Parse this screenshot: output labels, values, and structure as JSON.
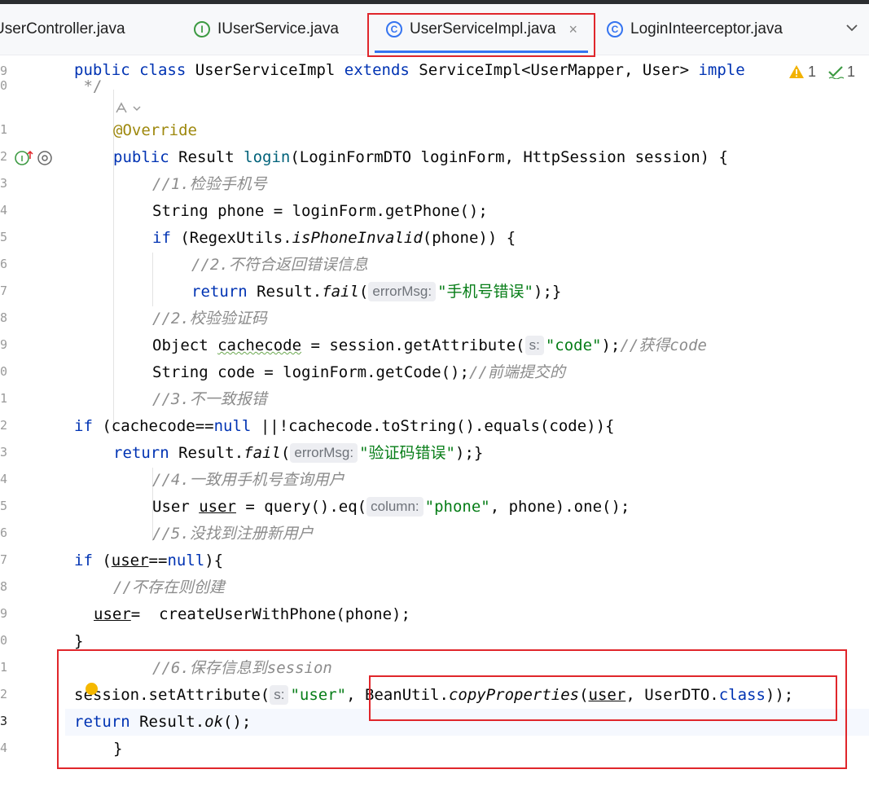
{
  "tabs": [
    {
      "label": "UserController.java",
      "icon": "class-icon",
      "active": false
    },
    {
      "label": "IUserService.java",
      "icon": "interface-icon",
      "active": false
    },
    {
      "label": "UserServiceImpl.java",
      "icon": "class-icon",
      "active": true
    },
    {
      "label": "LoginInteerceptor.java",
      "icon": "class-icon",
      "active": false
    }
  ],
  "tab_close": "×",
  "inspections": {
    "warnings": "1",
    "ok": "1"
  },
  "gutter_numbers": [
    "9",
    "0",
    "",
    "1",
    "2",
    "3",
    "4",
    "5",
    "6",
    "7",
    "8",
    "9",
    "0",
    "1",
    "2",
    "3",
    "4",
    "5",
    "6",
    "7",
    "8",
    "9",
    "0",
    "1",
    "2",
    "3",
    "4",
    ""
  ],
  "code": {
    "class_decl": {
      "kw1": "public",
      "kw2": "class",
      "name": " UserServiceImpl ",
      "kw3": "extends",
      "rest": " ServiceImpl<UserMapper, User> ",
      "kw4": "imple"
    },
    "doc_end": " */",
    "annotation": "@Override",
    "login_sig": {
      "kw": "public",
      "t1": " Result ",
      "fn": "login",
      "rest": "(LoginFormDTO loginForm, HttpSession session) {"
    },
    "c1": "//1.检验手机号",
    "phone_line": "String phone = loginForm.getPhone();",
    "if1": {
      "kw": "if",
      "a": " (RegexUtils.",
      "it": "isPhoneInvalid",
      "b": "(phone)) {"
    },
    "c2": "//2.不符合返回错误信息",
    "ret1": {
      "kw": "return",
      "a": " Result.",
      "it": "fail",
      "b": "(",
      "hint": "errorMsg:",
      "str": "\"手机号错误\"",
      "c": ");}"
    },
    "c3": "//2.校验验证码",
    "cache_line": {
      "a": "Object ",
      "v": "cachecode",
      "b": " = session.getAttribute(",
      "hint": "s:",
      "str": "\"code\"",
      "c": ");",
      "cm": "//获得code"
    },
    "code_line": {
      "a": "String code = loginForm.getCode();",
      "cm": "//前端提交的"
    },
    "c4": "//3.不一致报错",
    "if2": {
      "kw": "if",
      "a": " (cachecode==",
      "kwn": "null",
      "b": " ||!cachecode.toString().equals(code)){"
    },
    "ret2": {
      "kw": "return",
      "a": " Result.",
      "it": "fail",
      "b": "(",
      "hint": "errorMsg:",
      "str": "\"验证码错误\"",
      "c": ");}"
    },
    "c5": "//4.一致用手机号查询用户",
    "user_line": {
      "a": "User ",
      "v": "user",
      "b": " = query().eq(",
      "hint": "column:",
      "str": "\"phone\"",
      "c": ", phone).one();"
    },
    "c6": "//5.没找到注册新用户",
    "if3": {
      "kw": "if",
      "a": " (",
      "v": "user",
      "b": "==",
      "kwn": "null",
      "c": "){"
    },
    "c7": "//不存在则创建",
    "create_line": {
      "v": "user",
      "a": "=  createUserWithPhone(phone);"
    },
    "close1": "}",
    "c8": "//6.保存信息到session",
    "set_line": {
      "a": "session.setAttribute(",
      "hint": "s:",
      "str": "\"user\"",
      "b": ", BeanUtil.",
      "it": "copyProperties",
      "c": "(",
      "v": "user",
      "d": ", UserDTO.",
      "kw": "class",
      "e": "));"
    },
    "ret3": {
      "kw": "return",
      "a": " Result.",
      "it": "ok",
      "b": "();"
    },
    "close2": "}"
  }
}
